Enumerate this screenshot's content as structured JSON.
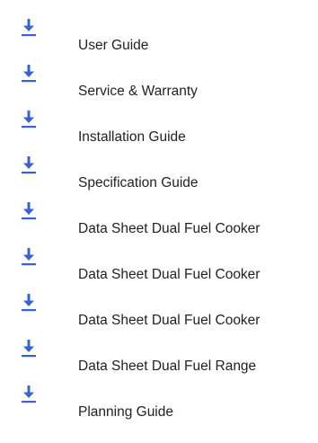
{
  "accent_color": "#3a63c9",
  "downloads": {
    "icon": "download-icon",
    "items": [
      {
        "label": "User Guide"
      },
      {
        "label": "Service & Warranty"
      },
      {
        "label": "Installation Guide"
      },
      {
        "label": "Specification Guide"
      },
      {
        "label": "Data Sheet Dual Fuel Cooker"
      },
      {
        "label": "Data Sheet Dual Fuel Cooker"
      },
      {
        "label": "Data Sheet Dual Fuel Cooker"
      },
      {
        "label": "Data Sheet Dual Fuel Range"
      },
      {
        "label": "Planning Guide"
      }
    ]
  }
}
